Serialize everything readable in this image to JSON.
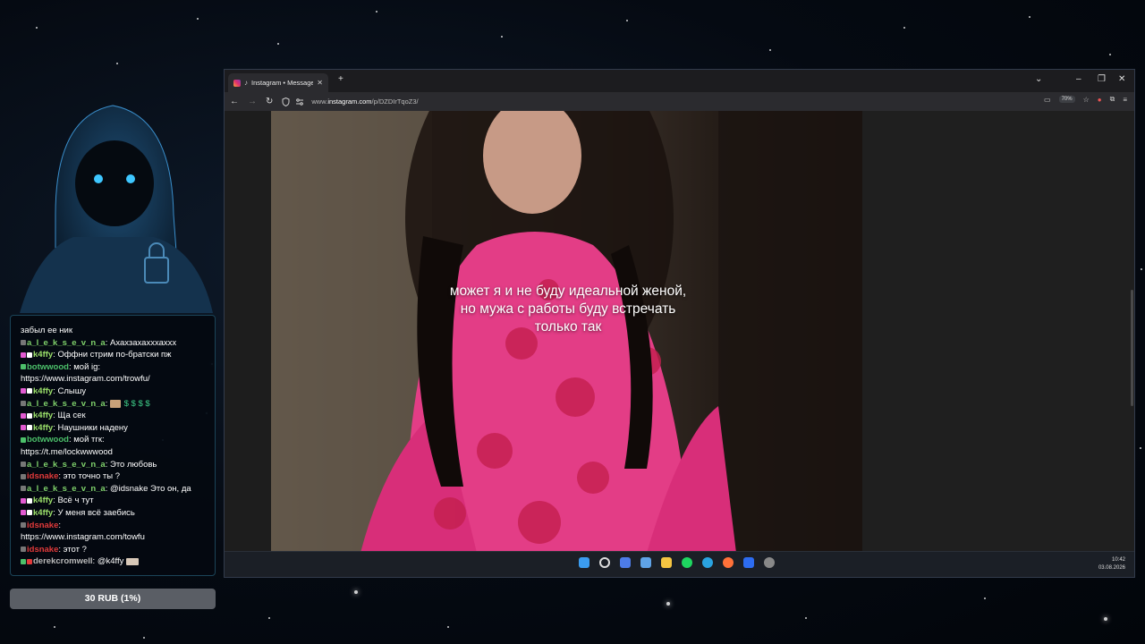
{
  "stream": {
    "chat_messages": [
      {
        "user": "",
        "text": "забыл ее ник",
        "color": "#ffffff"
      },
      {
        "user": "a_l_e_k_s_e_v_n_a",
        "text": "Ахахзахахххаххх",
        "color": "#7fd16b"
      },
      {
        "user": "k4ffy",
        "text": "Оффни стрим по-братски пж",
        "color": "#9be06a"
      },
      {
        "user": "botwwood",
        "text": "мой ig:",
        "color": "#4cc06a"
      },
      {
        "user": "",
        "text": "https://www.instagram.com/trowfu/",
        "color": "#ffffff"
      },
      {
        "user": "k4ffy",
        "text": "Слышу",
        "color": "#9be06a"
      },
      {
        "user": "a_l_e_k_s_e_v_n_a",
        "text": "",
        "color": "#7fd16b"
      },
      {
        "user": "k4ffy",
        "text": "Ща сек",
        "color": "#9be06a"
      },
      {
        "user": "k4ffy",
        "text": "Наушники надену",
        "color": "#9be06a"
      },
      {
        "user": "botwwood",
        "text": "мой тгк:",
        "color": "#4cc06a"
      },
      {
        "user": "",
        "text": "https://t.me/lockwwwood",
        "color": "#ffffff"
      },
      {
        "user": "a_l_e_k_s_e_v_n_a",
        "text": "Это любовь",
        "color": "#7fd16b"
      },
      {
        "user": "idsnake",
        "text": "это точно ты ?",
        "color": "#e23a3a"
      },
      {
        "user": "a_l_e_k_s_e_v_n_a",
        "text": "@idsnake Это он, да",
        "color": "#7fd16b"
      },
      {
        "user": "k4ffy",
        "text": "Всё ч тут",
        "color": "#9be06a"
      },
      {
        "user": "k4ffy",
        "text": "У меня всё заебись",
        "color": "#9be06a"
      },
      {
        "user": "idsnake",
        "text": "",
        "color": "#e23a3a"
      },
      {
        "user": "",
        "text": "https://www.instagram.com/towfu",
        "color": "#ffffff"
      },
      {
        "user": "idsnake",
        "text": "этот ?",
        "color": "#e23a3a"
      },
      {
        "user": "derekcromwell",
        "text": "@k4ffy",
        "color": "#bbbbbb"
      }
    ],
    "donate_label": "30 RUB (1%)"
  },
  "browser": {
    "tab_title": "Instagram • Messages",
    "new_tab": "+",
    "url_prefix": "www.",
    "url_domain": "instagram.com",
    "url_path": "/p/DZDIrTqoZ3/",
    "zoom": "70%",
    "buttons": {
      "back": "←",
      "forward": "→",
      "reload": "↻",
      "minimize": "–",
      "restore": "❐",
      "close": "✕",
      "dropdown": "⌄",
      "menu": "≡"
    }
  },
  "video": {
    "caption_lines": [
      "может я и не буду идеальной женой,",
      "но мужа с работы буду встречать",
      "только так"
    ]
  },
  "taskbar": {
    "time": "10:42",
    "date": "03.08.2026"
  }
}
